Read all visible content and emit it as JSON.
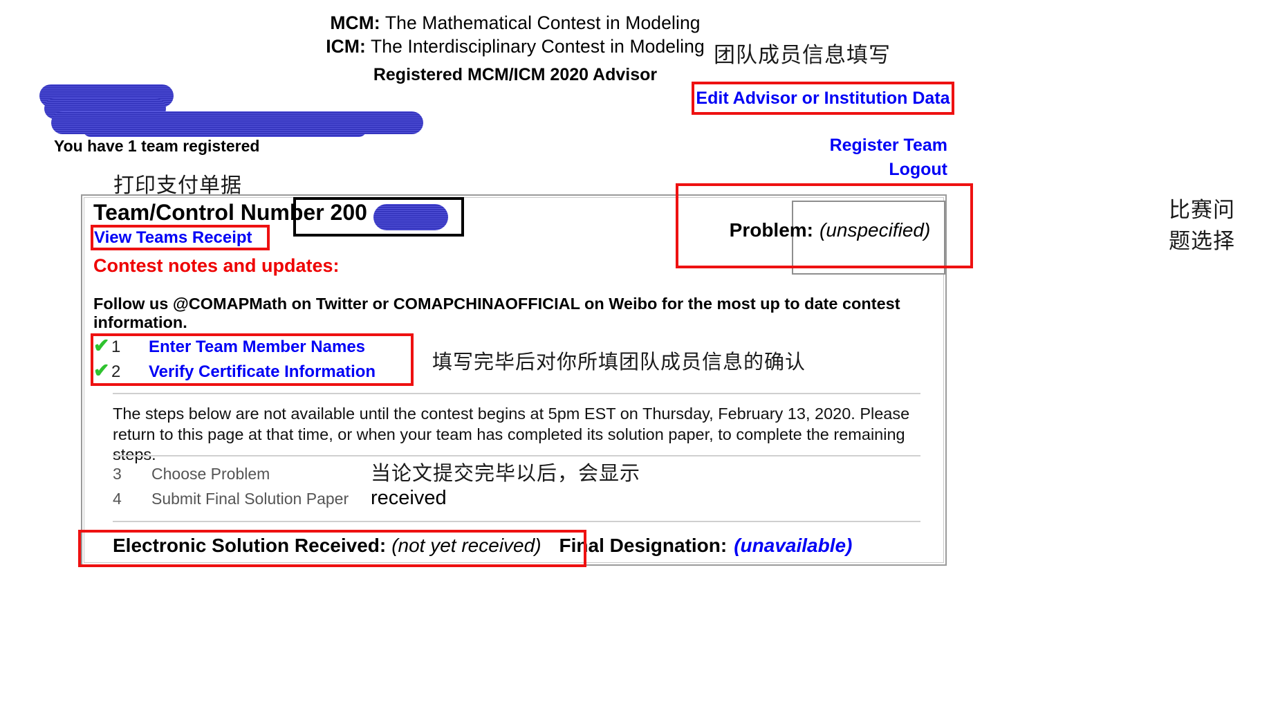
{
  "header": {
    "line1_label": "MCM:",
    "line1_text": "The Mathematical Contest in Modeling",
    "line2_label": "ICM:",
    "line2_text": "The Interdisciplinary Contest in Modeling",
    "advisor_line": "Registered MCM/ICM 2020 Advisor"
  },
  "account": {
    "teams_registered": "You have 1 team registered"
  },
  "links": {
    "edit_advisor": "Edit Advisor or Institution Data",
    "register_team": "Register Team",
    "logout": "Logout",
    "view_teams_receipt": "View Teams Receipt"
  },
  "annotations_cn": {
    "team_member_info": "团队成员信息填写",
    "print_payment_receipt": "打印支付单据",
    "confirm_member_info": "填写完毕后对你所填团队成员信息的确认",
    "after_submission_shows": "当论文提交完毕以后，会显示",
    "received_word": "received",
    "problem_choice_line1": "比赛问",
    "problem_choice_line2": "题选择"
  },
  "panel": {
    "team_number_label": "Team/Control Number",
    "team_number_value": "200",
    "problem_label": "Problem:",
    "problem_value": "(unspecified)",
    "contest_notes_title": "Contest notes and updates:",
    "follow_text": "Follow us @COMAPMath on Twitter or COMAPCHINAOFFICIAL on Weibo for the most up to date contest information.",
    "notice_paragraph": "The steps below are not available until the contest begins at 5pm EST on Thursday, February 13, 2020. Please return to this page at that time, or when your team has completed its solution paper, to complete the remaining steps.",
    "steps_done": [
      {
        "check": "✔",
        "num": "1",
        "label": "Enter Team Member Names"
      },
      {
        "check": "✔",
        "num": "2",
        "label": "Verify Certificate Information"
      }
    ],
    "steps_pending": [
      {
        "num": "3",
        "label": "Choose Problem"
      },
      {
        "num": "4",
        "label": "Submit Final Solution Paper"
      }
    ],
    "electronic_solution_label": "Electronic Solution Received:",
    "electronic_solution_value": "(not yet received)",
    "final_designation_label": "Final Designation:",
    "final_designation_value": "(unavailable)"
  },
  "colors": {
    "link_blue": "#0000f5",
    "annotation_red": "#ee1111",
    "notes_red": "#ee0000",
    "check_green": "#2fc22f",
    "redaction_blue": "#3b3bd4"
  }
}
